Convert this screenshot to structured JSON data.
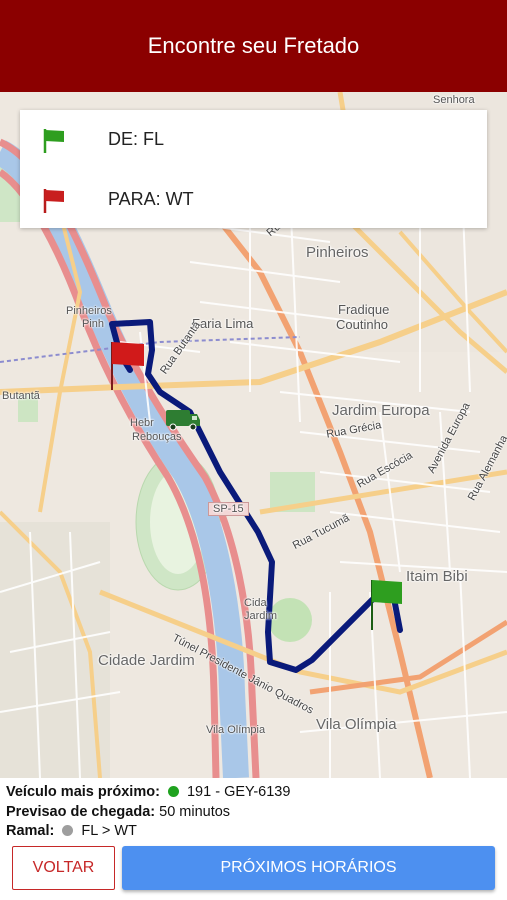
{
  "header": {
    "title": "Encontre seu Fretado"
  },
  "route": {
    "from_label": "DE: FL",
    "to_label": "PARA: WT"
  },
  "map": {
    "labels": {
      "senhora": "Senhora",
      "pinheiros": "Pinheiros",
      "pinheiros_station": "Pinheiros",
      "pinheiros_station2": "Pinh",
      "faria_lima": "Faria Lima",
      "fradique": "Fradique",
      "coutinho": "Coutinho",
      "butanta": "Butantã",
      "hebraica": "Hebr",
      "reboucas": "Rebouças",
      "jardim_europa": "Jardim Europa",
      "rua_grecia": "Rua Grécia",
      "rua_escocia": "Rua Escócia",
      "avenida_europa": "Avenida Europa",
      "rua_alemanha": "Rua Alemanha",
      "rua_tucuma": "Rua Tucumã",
      "sp15": "SP-15",
      "itaim_bibi": "Itaim Bibi",
      "tunel": "Túnel Presidente Jânio Quadros",
      "cidade_jardim": "Cidade Jardim",
      "cidade_jardim_station_1": "Cida",
      "cidade_jardim_station_2": "Jardim",
      "vila_olimpia": "Vila Olímpia",
      "vila_olimpia_station": "Vila Olímpia",
      "rua_butanta": "Rua Butantã",
      "rua": "Rua"
    },
    "colors": {
      "route": "#0a1a7a",
      "start_flag": "#2e9e1f",
      "end_flag": "#d11a1a",
      "bus": "#2e7d32"
    }
  },
  "info": {
    "vehicle_label": "Veículo mais próximo:",
    "vehicle_value": "191 - GEY-6139",
    "vehicle_dot_color": "#1fa21f",
    "arrival_label": "Previsao de chegada:",
    "arrival_value": "50 minutos",
    "ramal_label": "Ramal:",
    "ramal_value": "FL > WT",
    "ramal_dot_color": "#9e9e9e"
  },
  "buttons": {
    "back": "VOLTAR",
    "next_times": "PRÓXIMOS HORÁRIOS"
  }
}
